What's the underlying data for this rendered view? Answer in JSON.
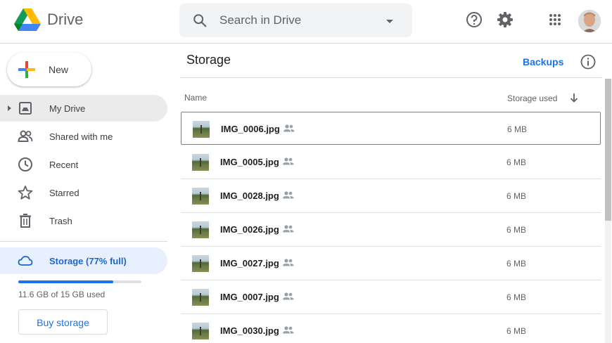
{
  "header": {
    "brand": "Drive",
    "search_placeholder": "Search in Drive"
  },
  "sidebar": {
    "new_label": "New",
    "items": [
      {
        "label": "My Drive",
        "icon": "my-drive-icon"
      },
      {
        "label": "Shared with me",
        "icon": "shared-with-me-icon"
      },
      {
        "label": "Recent",
        "icon": "clock-icon"
      },
      {
        "label": "Starred",
        "icon": "star-icon"
      },
      {
        "label": "Trash",
        "icon": "trash-icon"
      }
    ],
    "storage_label": "Storage (77% full)",
    "quota_fraction": 0.77,
    "quota_text": "11.6 GB of 15 GB used",
    "buy_label": "Buy storage"
  },
  "main": {
    "title": "Storage",
    "backups_label": "Backups",
    "col_name": "Name",
    "col_storage": "Storage used",
    "files": [
      {
        "name": "IMG_0006.jpg",
        "size": "6 MB"
      },
      {
        "name": "IMG_0005.jpg",
        "size": "6 MB"
      },
      {
        "name": "IMG_0028.jpg",
        "size": "6 MB"
      },
      {
        "name": "IMG_0026.jpg",
        "size": "6 MB"
      },
      {
        "name": "IMG_0027.jpg",
        "size": "6 MB"
      },
      {
        "name": "IMG_0007.jpg",
        "size": "6 MB"
      },
      {
        "name": "IMG_0030.jpg",
        "size": "6 MB"
      }
    ]
  },
  "colors": {
    "accent": "#1a73e8",
    "selected_bg": "#e8f0fe",
    "active_bg": "#ebebeb"
  }
}
